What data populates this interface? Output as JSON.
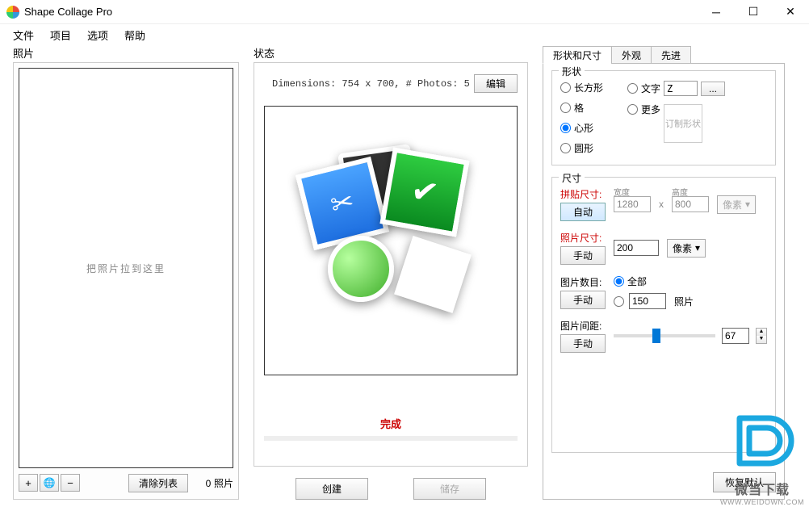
{
  "titlebar": {
    "title": "Shape Collage Pro"
  },
  "menu": {
    "file": "文件",
    "project": "项目",
    "options": "选项",
    "help": "帮助"
  },
  "left": {
    "label": "照片",
    "placeholder": "把照片拉到这里",
    "add": "+",
    "web": "🌐",
    "remove": "−",
    "clear": "清除列表",
    "count_num": "0",
    "count_label": "照片"
  },
  "center": {
    "label": "状态",
    "dimensions": "Dimensions: 754 x 700, # Photos: 5",
    "edit": "编辑",
    "status": "完成",
    "create": "创建",
    "save": "储存"
  },
  "right": {
    "tabs": {
      "shape": "形状和尺寸",
      "appearance": "外观",
      "advanced": "先进"
    },
    "shape": {
      "title": "形状",
      "rect": "长方形",
      "grid": "格",
      "heart": "心形",
      "circle": "圆形",
      "text": "文字",
      "text_value": "Z",
      "more": "更多",
      "browse": "...",
      "custom": "订制形状"
    },
    "size": {
      "title": "尺寸",
      "collage_label": "拼贴尺寸:",
      "auto": "自动",
      "width_label": "宽度",
      "height_label": "高度",
      "width": "1280",
      "height": "800",
      "unit": "像素",
      "photo_label": "照片尺寸:",
      "manual": "手动",
      "photo_value": "200",
      "count_label": "图片数目:",
      "all": "全部",
      "count_value": "150",
      "count_unit": "照片",
      "spacing_label": "图片间距:",
      "spacing_value": "67"
    },
    "restore": "恢复默认"
  },
  "watermark": {
    "name": "微当下载",
    "url": "WWW.WEIDOWN.COM"
  }
}
